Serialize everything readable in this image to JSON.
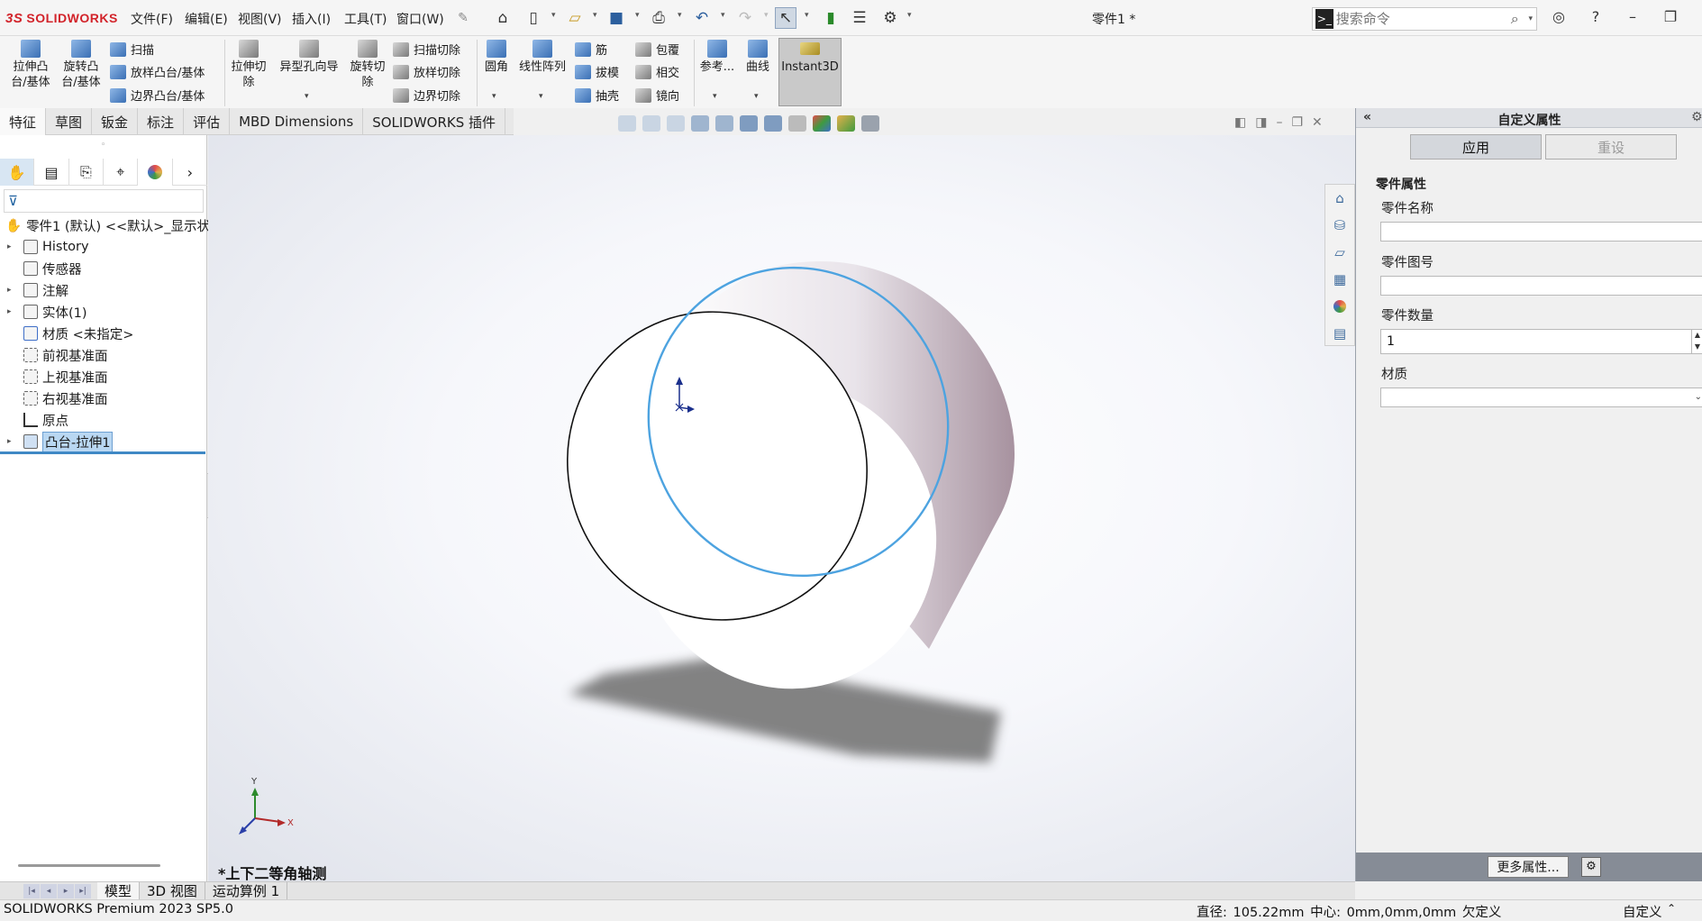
{
  "app": {
    "logo": "SOLIDWORKS",
    "document_title": "零件1 *"
  },
  "menu": [
    "文件(F)",
    "编辑(E)",
    "视图(V)",
    "插入(I)",
    "工具(T)",
    "窗口(W)"
  ],
  "quick_access_icons": [
    "home-icon",
    "new-file-icon",
    "open-icon",
    "save-icon",
    "print-icon",
    "undo-icon",
    "redo-icon",
    "select-icon",
    "rebuild-icon",
    "file-properties-icon",
    "options-icon"
  ],
  "search": {
    "placeholder": "搜索命令"
  },
  "ribbon": {
    "extrude_boss": "拉伸凸\n台/基体",
    "revolve_boss": "旋转凸\n台/基体",
    "sweep": "扫描",
    "loft_boss": "放样凸台/基体",
    "boundary_boss": "边界凸台/基体",
    "extrude_cut": "拉伸切\n除",
    "hole_wizard": "异型孔向导",
    "revolve_cut": "旋转切\n除",
    "sweep_cut": "扫描切除",
    "loft_cut": "放样切除",
    "boundary_cut": "边界切除",
    "fillet": "圆角",
    "linear_pattern": "线性阵列",
    "rib": "筋",
    "draft": "拔模",
    "shell": "抽壳",
    "wrap": "包覆",
    "intersect": "相交",
    "mirror": "镜向",
    "reference": "参考...",
    "curves": "曲线",
    "instant3d": "Instant3D"
  },
  "command_tabs": [
    "特征",
    "草图",
    "钣金",
    "标注",
    "评估",
    "MBD Dimensions",
    "SOLIDWORKS 插件"
  ],
  "feature_tree": {
    "root": "零件1 (默认) <<默认>_显示状",
    "items": [
      {
        "label": "History",
        "expandable": true
      },
      {
        "label": "传感器",
        "expandable": false
      },
      {
        "label": "注解",
        "expandable": true
      },
      {
        "label": "实体(1)",
        "expandable": true
      },
      {
        "label": "材质 <未指定>",
        "expandable": false
      },
      {
        "label": "前视基准面",
        "expandable": false
      },
      {
        "label": "上视基准面",
        "expandable": false
      },
      {
        "label": "右视基准面",
        "expandable": false
      },
      {
        "label": "原点",
        "expandable": false
      },
      {
        "label": "凸台-拉伸1",
        "expandable": true,
        "selected": true
      }
    ]
  },
  "viewport": {
    "view_orientation_label": "*上下二等角轴测",
    "triad": {
      "x": "X",
      "y": "Y"
    },
    "accent_edge_color": "#4da3e0"
  },
  "properties_pane": {
    "title": "自定义属性",
    "apply": "应用",
    "reset": "重设",
    "group": "零件属性",
    "fields": {
      "part_name": {
        "label": "零件名称",
        "value": ""
      },
      "part_number": {
        "label": "零件图号",
        "value": ""
      },
      "quantity": {
        "label": "零件数量",
        "value": "1"
      },
      "material": {
        "label": "材质",
        "value": ""
      }
    },
    "more_button": "更多属性..."
  },
  "bottom_tabs": [
    "模型",
    "3D 视图",
    "运动算例 1"
  ],
  "status": {
    "product": "SOLIDWORKS Premium 2023 SP5.0",
    "measure": "直径: 105.22mm  中心: 0mm,0mm,0mm  欠定义",
    "units": "自定义"
  }
}
